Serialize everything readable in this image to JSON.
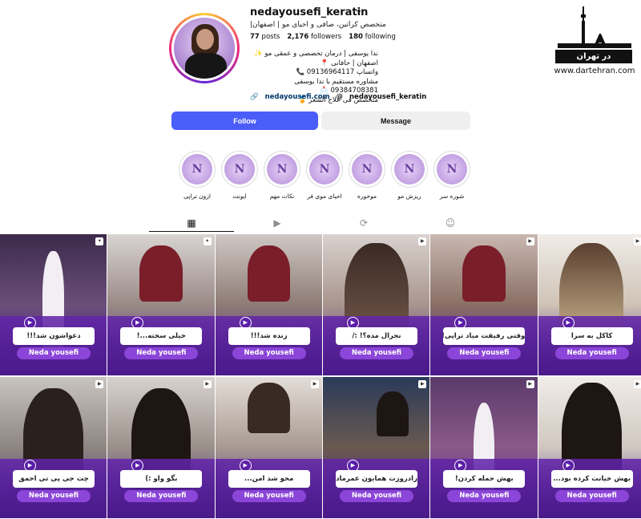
{
  "profile": {
    "username": "nedayousefi_keratin",
    "more": "···",
    "subtitle": "متخصص کراتین، صافی و احیای مو | اصفهان|",
    "stats": {
      "posts_count": "77",
      "posts_label": "posts",
      "followers_count": "2,176",
      "followers_label": "followers",
      "following_count": "180",
      "following_label": "following"
    },
    "bio": [
      "ندا یوسفی | درمان تخصصی و عمقی مو ✨",
      "اصفهان | حافانی 📍",
      "واتساپ 09136964117 📞",
      "مشاوره مستقیم با ندا یوسفی 09384708381 📩",
      "متخصص فی علاج الشعر 🏅"
    ],
    "website": "nedayousefi.com",
    "threads": "nedayousefi_keratin"
  },
  "buttons": {
    "follow": "Follow",
    "message": "Message"
  },
  "logo": {
    "name": "در تهران",
    "url": "www.dartehran.com"
  },
  "highlights": [
    {
      "label": "شوره سر"
    },
    {
      "label": "ریزش مو"
    },
    {
      "label": "موخوره"
    },
    {
      "label": "احیای موی فر"
    },
    {
      "label": "نکات مهم"
    },
    {
      "label": "ایونت"
    },
    {
      "label": "ازون تراپی"
    }
  ],
  "tabs": [
    "posts-grid",
    "reels",
    "reposts",
    "tagged"
  ],
  "posts": [
    {
      "caption": "دعواشون شد!!!",
      "brand": "Neda yousefi"
    },
    {
      "caption": "خیلی سخته...!",
      "brand": "Neda yousefi"
    },
    {
      "caption": "زنده شد!!!",
      "brand": "Neda yousefi"
    },
    {
      "caption": "نجرال مده؟! :/",
      "brand": "Neda yousefi"
    },
    {
      "caption": "وقتی رفیقت میاد تراپی!",
      "brand": "Neda yousefi"
    },
    {
      "caption": "کاکل به سرا",
      "brand": "Neda yousefi"
    },
    {
      "caption": "چت جی پی تی احمق",
      "brand": "Neda yousefi"
    },
    {
      "caption": "بگو واو :)",
      "brand": "Neda yousefi"
    },
    {
      "caption": "محو شد امن...",
      "brand": "Neda yousefi"
    },
    {
      "caption": "زادروزت همایون عمرمادر",
      "brand": "Neda yousefi"
    },
    {
      "caption": "بهش حمله کردن!",
      "brand": "Neda yousefi"
    },
    {
      "caption": "بهش خیانت کرده بود...",
      "brand": "Neda yousefi"
    }
  ],
  "colors": {
    "follow": "#4a5df9",
    "purple": "#5b1fa8"
  }
}
